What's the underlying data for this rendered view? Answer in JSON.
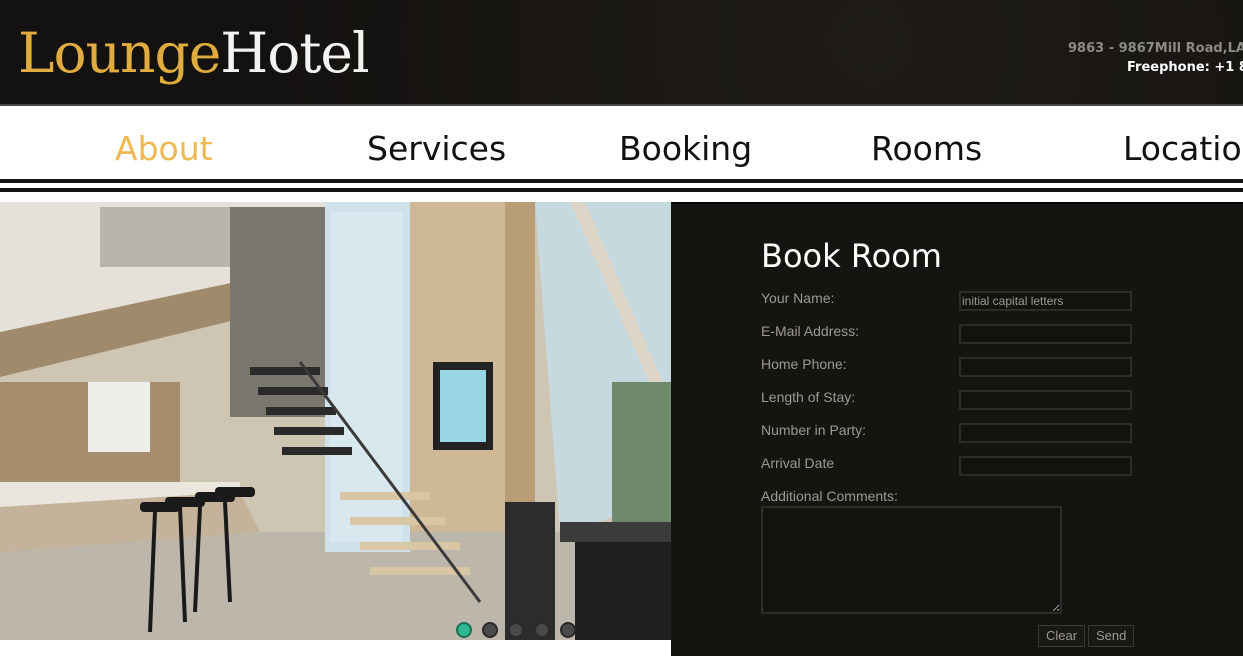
{
  "brand": {
    "part1": "Lounge",
    "part2": "Hotel"
  },
  "contact": {
    "address": "9863 - 9867Mill Road,LA,",
    "phone": "Freephone: +1 8"
  },
  "nav": {
    "items": [
      {
        "label": "About",
        "active": true
      },
      {
        "label": "Services",
        "active": false
      },
      {
        "label": "Booking",
        "active": false
      },
      {
        "label": "Rooms",
        "active": false
      },
      {
        "label": "Location",
        "active": false
      }
    ]
  },
  "slider": {
    "slide_count": 5,
    "active_index": 0,
    "image": "interior-loft-kitchen-staircase"
  },
  "form": {
    "title": "Book Room",
    "fields": [
      {
        "label": "Your Name:",
        "value": "initial capital letters"
      },
      {
        "label": "E-Mail Address:",
        "value": ""
      },
      {
        "label": "Home Phone:",
        "value": ""
      },
      {
        "label": "Length of Stay:",
        "value": ""
      },
      {
        "label": "Number in Party:",
        "value": ""
      },
      {
        "label": "Arrival Date",
        "value": ""
      }
    ],
    "comments_label": "Additional Comments:",
    "comments_value": "",
    "clear_label": "Clear",
    "send_label": "Send"
  },
  "colors": {
    "accent": "#efb852",
    "logo_gold": "#e0ab3f",
    "header_bg": "#161411",
    "dot_active": "#2fb893"
  }
}
